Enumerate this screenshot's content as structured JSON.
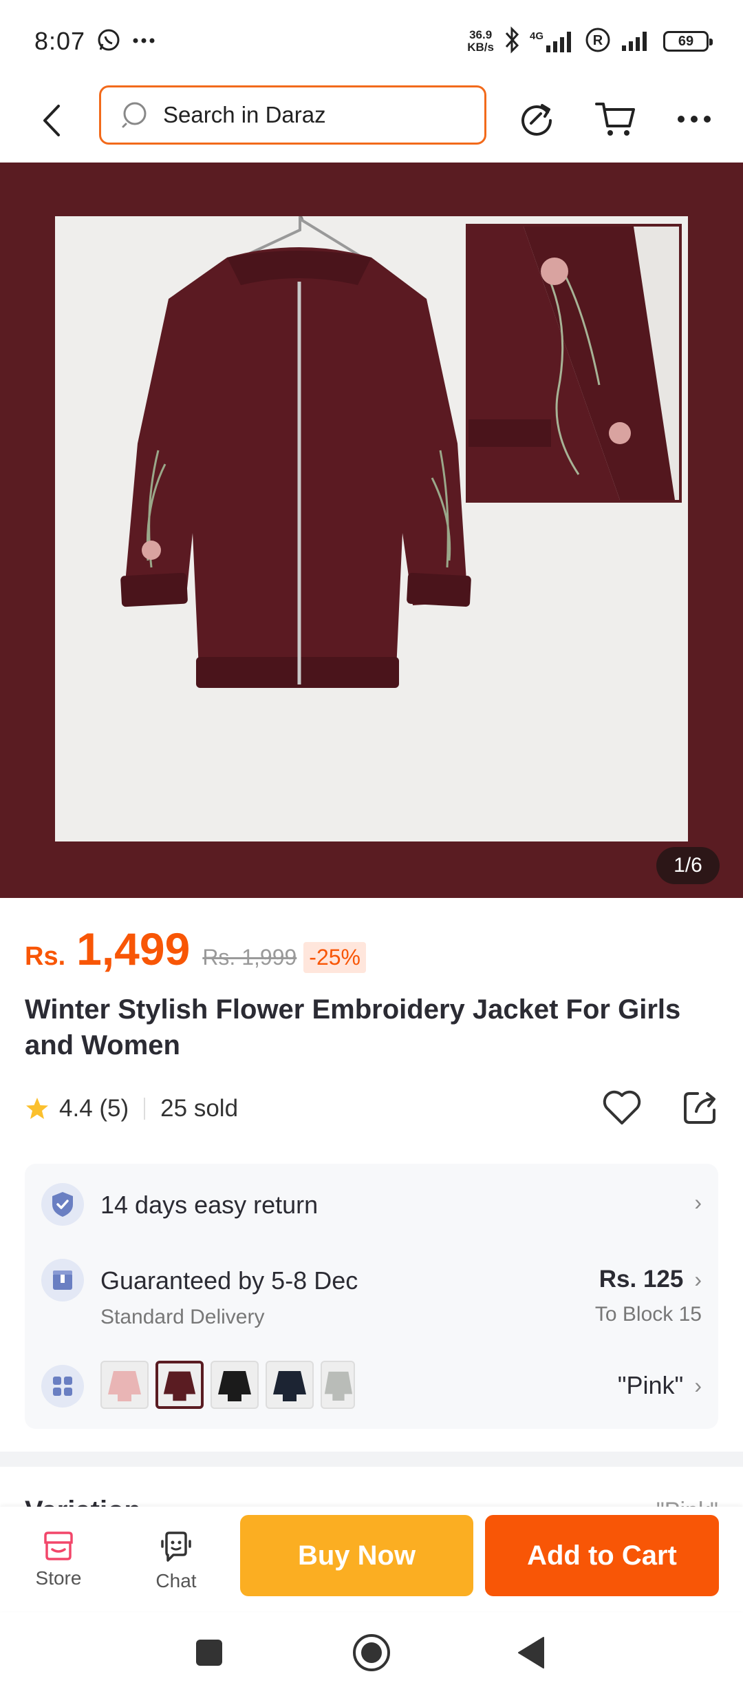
{
  "status_bar": {
    "time": "8:07",
    "net_speed_value": "36.9",
    "net_speed_unit": "KB/s",
    "network_label": "4G",
    "battery": "69",
    "icons": [
      "whatsapp-icon",
      "more-dots-icon",
      "bluetooth-icon",
      "signal-icon",
      "registered-icon",
      "signal-icon"
    ]
  },
  "nav": {
    "search_placeholder": "Search in Daraz",
    "icons": [
      "back-arrow-icon",
      "search-icon",
      "share-refresh-icon",
      "cart-icon",
      "more-dots-icon"
    ]
  },
  "gallery": {
    "counter": "1/6"
  },
  "product": {
    "currency": "Rs.",
    "price": "1,499",
    "old_price": "Rs. 1,999",
    "discount": "-25%",
    "title": "Winter Stylish Flower Embroidery Jacket For Girls and Women",
    "rating": "4.4",
    "reviews": "(5)",
    "sold": "25 sold"
  },
  "info": {
    "returns": "14 days easy return",
    "delivery_title": "Guaranteed by 5-8 Dec",
    "delivery_sub": "Standard Delivery",
    "delivery_price": "Rs. 125",
    "delivery_location": "To Block 15",
    "variant_selected": "\"Pink\"",
    "swatch_colors": [
      "#e9b5b5",
      "#5a1c22",
      "#1b1b1b",
      "#1c2433",
      "#b9bcb8"
    ]
  },
  "variation_peek": {
    "title": "Variation",
    "right": "\"Pink\""
  },
  "bottom_bar": {
    "store_label": "Store",
    "chat_label": "Chat",
    "buy_now": "Buy Now",
    "add_to_cart": "Add to Cart"
  },
  "colors": {
    "accent": "#f85606",
    "buy_now": "#fbae22",
    "gallery_bg": "#5a1c22"
  }
}
